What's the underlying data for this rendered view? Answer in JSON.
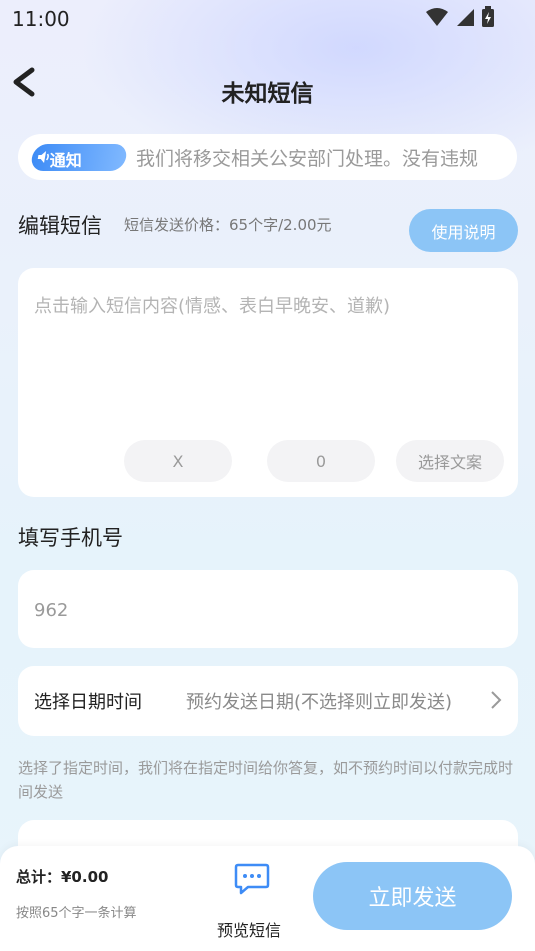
{
  "status_bar": {
    "time": "11:00"
  },
  "nav": {
    "title": "未知短信"
  },
  "notice": {
    "badge": "通知",
    "text": "我们将移交相关公安部门处理。没有违规"
  },
  "edit_sms": {
    "title": "编辑短信",
    "price_note": "短信发送价格：65个字/2.00元",
    "help_button": "使用说明",
    "placeholder": "点击输入短信内容(情感、表白早晚安、道歉)",
    "pill_x": "X",
    "pill_count": "0",
    "pill_template": "选择文案"
  },
  "phone": {
    "title": "填写手机号",
    "value": "962"
  },
  "schedule": {
    "label": "选择日期时间",
    "value": "预约发送日期(不选择则立即发送)",
    "note": "选择了指定时间，我们将在指定时间给你答复，如不预约时间以付款完成时间发送"
  },
  "bottom": {
    "total": "总计：¥0.00",
    "total_note": "按照65个字一条计算",
    "preview_label": "预览短信",
    "send_button": "立即发送"
  },
  "colors": {
    "accent": "#8CC5F6",
    "badge": "#3E8CF6"
  }
}
